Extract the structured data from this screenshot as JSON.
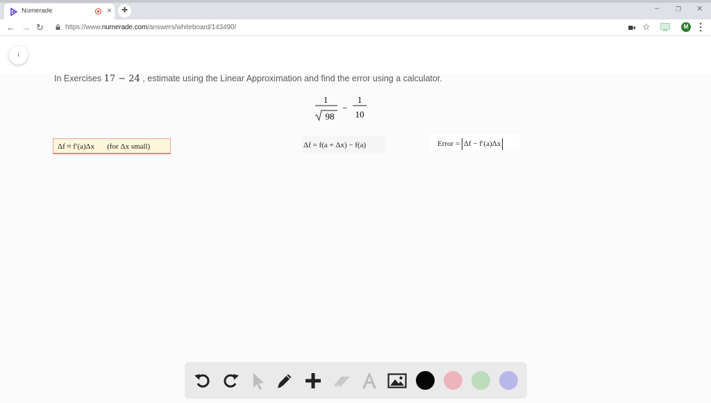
{
  "browser": {
    "tab_title": "Numerade",
    "new_tab_label": "+",
    "url_prefix": "https://www.",
    "url_domain": "numerade.com",
    "url_path": "/answers/whiteboard/143490/",
    "profile_initial": "M",
    "close_label": "×",
    "minimize_label": "–",
    "restore_label": "❐",
    "window_close_label": "✕"
  },
  "page": {
    "page_number": "1",
    "prompt_before": "In Exercises ",
    "prompt_range_start": "17",
    "prompt_range_dash": " − ",
    "prompt_range_end": "24",
    "prompt_after": " , estimate using the Linear Approximation and find the error using a calculator.",
    "expression": {
      "num1": "1",
      "den1_radicand": "98",
      "operator": "−",
      "num2": "1",
      "den2": "10"
    },
    "formulas": {
      "linear_approx": "Δf ≈ f′(a)Δx",
      "linear_approx_note": "(for Δx small)",
      "delta_f": "Δf = f(a + Δx) − f(a)",
      "error_label": "Error =",
      "error_expr": "Δf − f′(a)Δx"
    }
  },
  "drawing_toolbar": {
    "tools": [
      "undo-icon",
      "redo-icon",
      "pointer-icon",
      "pen-icon",
      "add-icon",
      "eraser-icon",
      "text-icon",
      "image-icon"
    ],
    "colors": [
      "#050505",
      "#eeb4bb",
      "#bcdcbc",
      "#b9b7ea"
    ]
  }
}
